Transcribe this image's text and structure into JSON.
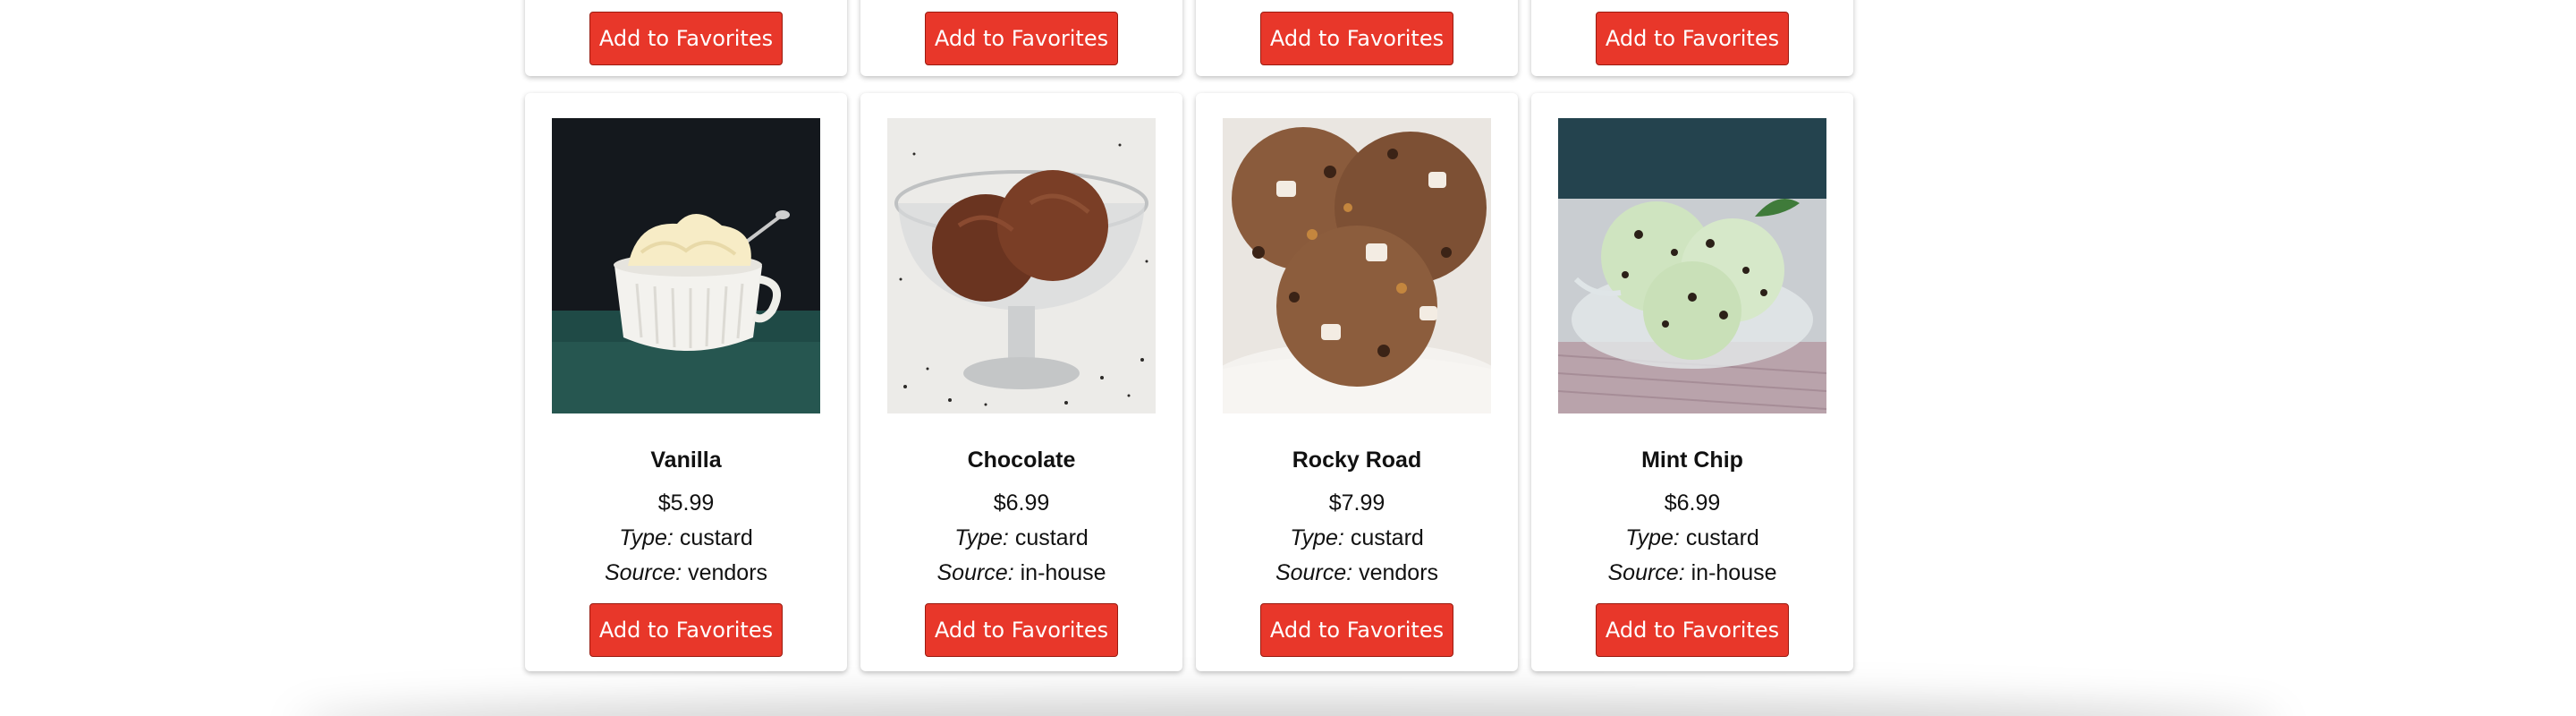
{
  "fav_button_label": "Add to Favorites",
  "type_label": "Type:",
  "source_label": "Source:",
  "accent_color": "#e8372a",
  "products": [
    {
      "name": "Vanilla",
      "price": "$5.99",
      "type": "custard",
      "source": "vendors",
      "photo": "vanilla-ice-cream-cup"
    },
    {
      "name": "Chocolate",
      "price": "$6.99",
      "type": "custard",
      "source": "in-house",
      "photo": "chocolate-ice-cream-glass-dish"
    },
    {
      "name": "Rocky Road",
      "price": "$7.99",
      "type": "custard",
      "source": "vendors",
      "photo": "rocky-road-ice-cream-scoops"
    },
    {
      "name": "Mint Chip",
      "price": "$6.99",
      "type": "custard",
      "source": "in-house",
      "photo": "mint-chip-ice-cream-glass-bowl"
    }
  ]
}
